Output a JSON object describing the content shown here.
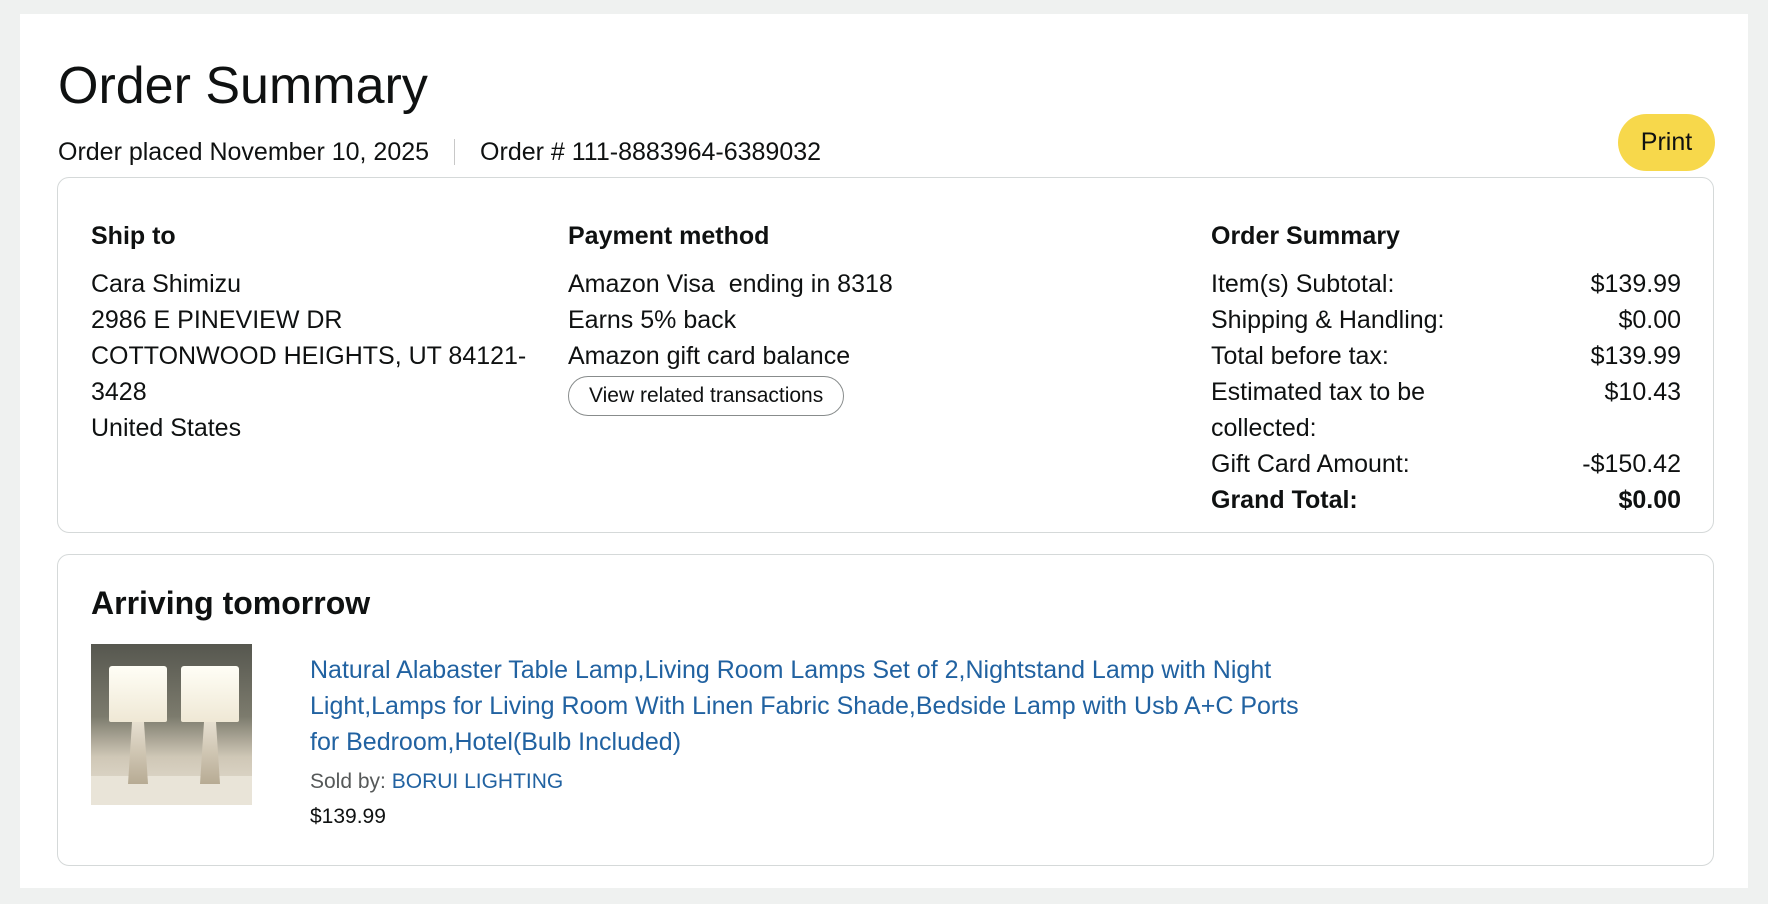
{
  "header": {
    "title": "Order Summary",
    "order_placed": "Order placed November 10, 2025",
    "order_number": "Order # 111-8883964-6389032",
    "print_label": "Print"
  },
  "ship_to": {
    "heading": "Ship to",
    "name": "Cara Shimizu",
    "street": "2986 E PINEVIEW DR",
    "city_line": "COTTONWOOD HEIGHTS, UT 84121-3428",
    "country": "United States"
  },
  "payment": {
    "heading": "Payment method",
    "card_brand": "Amazon Visa",
    "card_ending": "ending in 8318",
    "rewards": "Earns 5% back",
    "gift_card": "Amazon gift card balance",
    "related_button": "View related transactions"
  },
  "order_summary": {
    "heading": "Order Summary",
    "rows": [
      {
        "label": "Item(s) Subtotal:",
        "value": "$139.99"
      },
      {
        "label": "Shipping & Handling:",
        "value": "$0.00"
      },
      {
        "label": "Total before tax:",
        "value": "$139.99"
      },
      {
        "label": "Estimated tax to be collected:",
        "value": "$10.43"
      },
      {
        "label": "Gift Card Amount:",
        "value": "-$150.42"
      }
    ],
    "grand_total": {
      "label": "Grand Total:",
      "value": "$0.00"
    }
  },
  "shipment": {
    "status": "Arriving tomorrow",
    "product_title": "Natural Alabaster Table Lamp,Living Room Lamps Set of 2,Nightstand Lamp with Night Light,Lamps for Living Room With Linen Fabric Shade,Bedside Lamp with Usb A+C Ports for Bedroom,Hotel(Bulb Included)",
    "sold_by_label": "Sold by:",
    "seller": "BORUI LIGHTING",
    "price": "$139.99",
    "image_icon": "table-lamps-product-image"
  },
  "colors": {
    "print_button": "#f7d84b",
    "link": "#2162a1",
    "page_background": "#eff1f0"
  }
}
